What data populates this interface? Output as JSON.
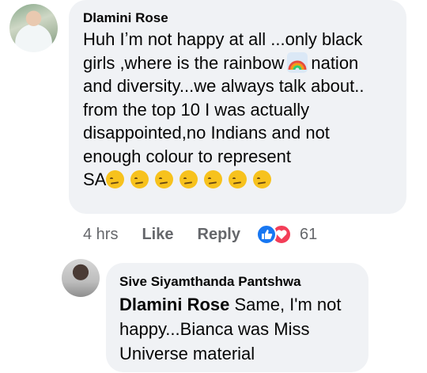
{
  "comment": {
    "author": "Dlamini Rose",
    "lines": [
      "Huh Iʼm not happy at all ...only black",
      "girls ,where is the rainbow",
      "nation",
      "and diversity...we always talk about..",
      "from the top 10 I was actually",
      "disappointed,no Indians and not",
      "enough colour to represent",
      "SA"
    ],
    "rainbow_icon": "rainbow-emoji",
    "emojis": [
      "face-with-raised-eyebrow",
      "face-with-raised-eyebrow",
      "face-with-raised-eyebrow",
      "face-with-raised-eyebrow",
      "face-with-raised-eyebrow",
      "face-with-raised-eyebrow",
      "unamused-face"
    ],
    "actions": {
      "time": "4 hrs",
      "like": "Like",
      "reply": "Reply",
      "reaction_count": "61"
    },
    "reactions": [
      "like",
      "love"
    ]
  },
  "reply": {
    "author": "Sive Siyamthanda Pantshwa",
    "mention": "Dlamini Rose",
    "text_first": " Same, I'm not",
    "lines": [
      "happy...Bianca was Miss",
      "Universe material"
    ]
  },
  "colors": {
    "bubble": "#f0f2f5",
    "text": "#050505",
    "meta": "#65676b",
    "like_blue": "#1877f2",
    "love_red": "#f33e58"
  }
}
